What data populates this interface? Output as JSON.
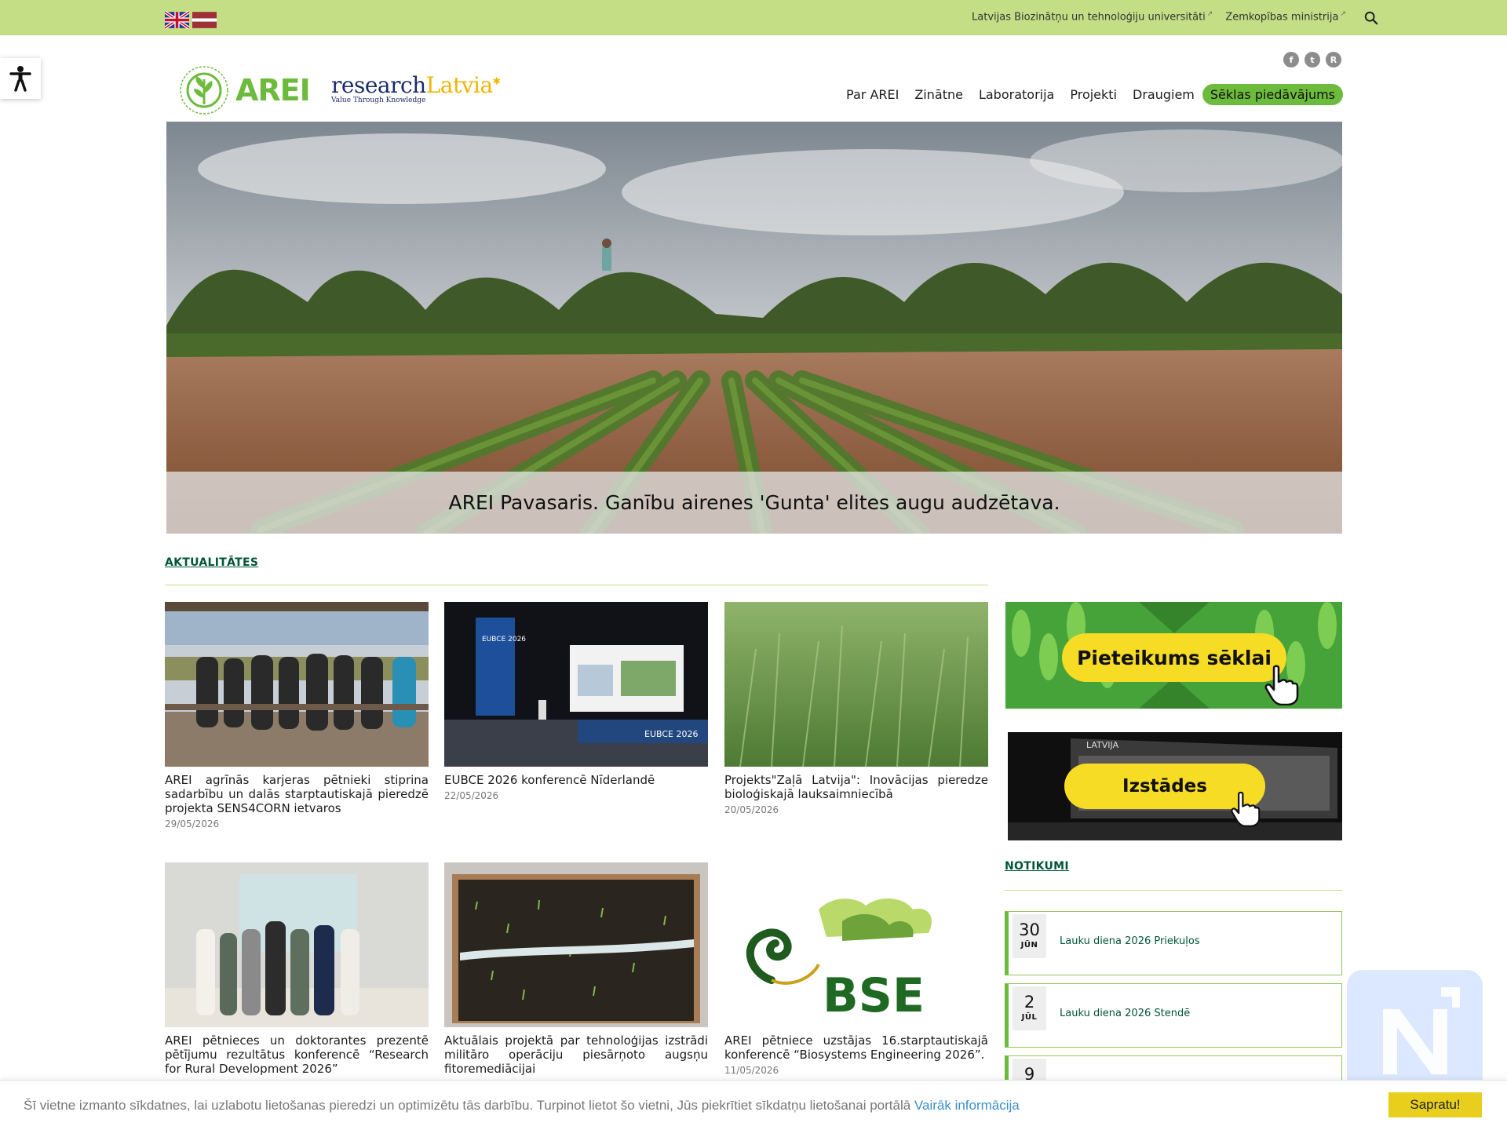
{
  "topbar": {
    "links": [
      "Latvijas Biozinātņu un tehnoloģiju universitāti",
      "Zemkopības ministrija"
    ]
  },
  "header": {
    "logo_text": "AREI",
    "rl_part1": "research",
    "rl_part2": "Latvia",
    "rl_tagline": "Value Through Knowledge",
    "nav": [
      "Par AREI",
      "Zinātne",
      "Laboratorija",
      "Projekti",
      "Draugiem",
      "Sēklas piedāvājums"
    ]
  },
  "hero": {
    "caption": "AREI Pavasaris. Ganību airenes 'Gunta' elites augu audzētava."
  },
  "news": {
    "heading": "AKTUALITĀTES",
    "items": [
      {
        "title": "AREI agrīnās karjeras pētnieki stiprina sadarbību un dalās starptautiskajā pieredzē projekta SENS4CORN ietvaros",
        "date": "29/05/2026"
      },
      {
        "title": "EUBCE 2026 konferencē Nīderlandē",
        "date": "22/05/2026"
      },
      {
        "title": "Projekts\"Zaļā Latvija\": Inovācijas pieredze bioloģiskajā lauksaimniecībā",
        "date": "20/05/2026"
      },
      {
        "title": "AREI pētnieces un doktorantes prezentē pētījumu rezultātus konferencē “Research for Rural Development 2026”",
        "date": ""
      },
      {
        "title": "Aktuālais projektā par tehnoloģijas izstrādi militāro operāciju piesārņoto augsņu fitoremediācijai",
        "date": ""
      },
      {
        "title": "AREI pētniece uzstājas 16.starptautiskajā konferencē “Biosystems Engineering 2026”.",
        "date": "11/05/2026"
      }
    ],
    "slide_text": {
      "eubce_banner": "EUBCE 2026",
      "eubce_podium": "EUBCE 2026",
      "bse_logo": "BSE"
    }
  },
  "sidebar": {
    "banner1": "Pieteikums sēklai",
    "banner2": "Izstādes",
    "banner2_label": "LATVIJA",
    "events_heading": "NOTIKUMI",
    "events": [
      {
        "day": "30",
        "month": "JŪN",
        "title": "Lauku diena 2026 Priekuļos"
      },
      {
        "day": "2",
        "month": "JŪL",
        "title": "Lauku diena 2026 Stendē"
      },
      {
        "day": "9",
        "month": "",
        "title": ""
      }
    ]
  },
  "cookie": {
    "text": "Šī vietne izmanto sīkdatnes, lai uzlabotu lietošanas pieredzi un optimizētu tās darbību. Turpinot lietot šo vietni, Jūs piekrītiet sīkdatņu lietošanai portālā",
    "link": "Vairāk informācija",
    "button": "Sapratu!"
  }
}
